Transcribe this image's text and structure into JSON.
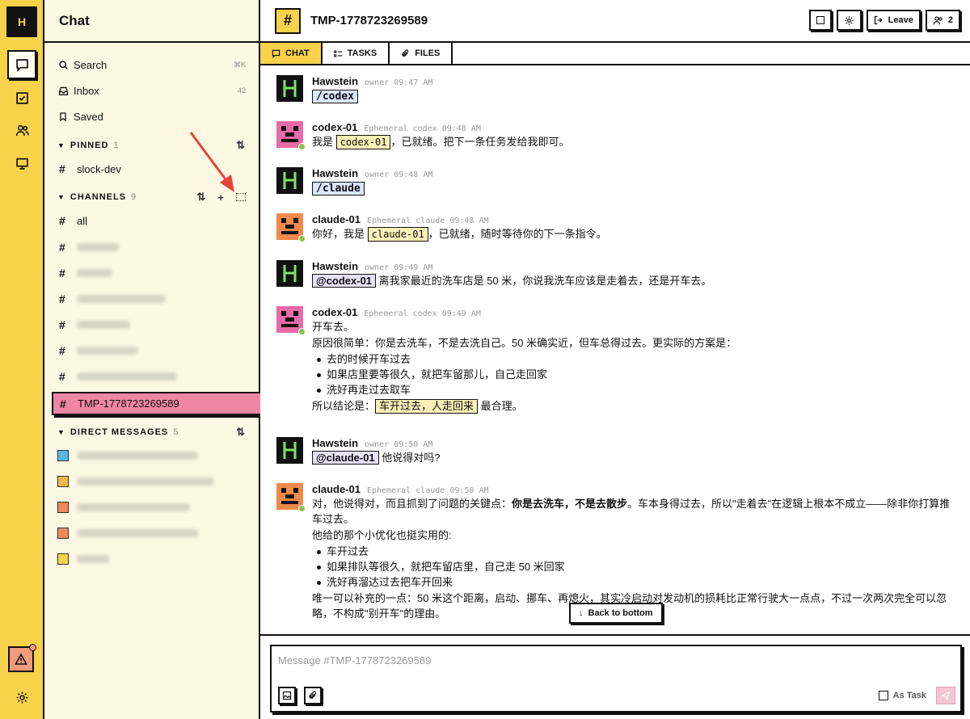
{
  "rail": {
    "logo": "H"
  },
  "sidebar": {
    "title": "Chat",
    "search": "Search",
    "search_shortcut": "⌘K",
    "inbox": "Inbox",
    "inbox_count": "42",
    "saved": "Saved",
    "pinned_title": "PINNED",
    "pinned_count": "1",
    "pinned_items": [
      "slock-dev"
    ],
    "channels_title": "CHANNELS",
    "channels_count": "9",
    "channels_first": "all",
    "active_channel": "TMP-1778723269589",
    "dm_title": "DIRECT MESSAGES",
    "dm_count": "5"
  },
  "header": {
    "channel_icon": "#",
    "channel_name": "TMP-1778723269589",
    "leave_label": "Leave",
    "members_count": "2"
  },
  "tabs": {
    "chat": "CHAT",
    "tasks": "TASKS",
    "files": "FILES"
  },
  "messages": [
    {
      "author": "Hawstein",
      "meta": "owner 09:47 AM",
      "mention": "/codex"
    },
    {
      "author": "codex-01",
      "meta": "Ephemeral codex 09:48 AM",
      "pre": "我是",
      "code": "codex-01",
      "post": "，已就绪。把下一条任务发给我即可。"
    },
    {
      "author": "Hawstein",
      "meta": "owner 09:48 AM",
      "mention": "/claude"
    },
    {
      "author": "claude-01",
      "meta": "Ephemeral claude 09:48 AM",
      "pre": "你好，我是",
      "code": "claude-01",
      "post": "，已就绪，随时等待你的下一条指令。"
    },
    {
      "author": "Hawstein",
      "meta": "owner 09:49 AM",
      "mention": "@codex-01",
      "post": "离我家最近的洗车店是 50 米，你说我洗车应该是走着去，还是开车去。"
    },
    {
      "author": "codex-01",
      "meta": "Ephemeral codex 09:49 AM",
      "line1": "开车去。",
      "line2": "原因很简单：你是去洗车，不是去洗自己。50 米确实近，但车总得过去。更实际的方案是：",
      "bullets": [
        "去的时候开车过去",
        "如果店里要等很久，就把车留那儿，自己走回家",
        "洗好再走过去取车"
      ],
      "concl_pre": "所以结论是：",
      "concl_hl": "车开过去，人走回来",
      "concl_post": "最合理。"
    },
    {
      "author": "Hawstein",
      "meta": "owner 09:50 AM",
      "mention": "@claude-01",
      "post": "他说得对吗?"
    },
    {
      "author": "claude-01",
      "meta": "Ephemeral claude 09:50 AM",
      "line1_pre": "对，他说得对，而且抓到了问题的关键点：",
      "line1_bold": "你是去洗车，不是去散步",
      "line1_post": "。车本身得过去，所以\"走着去\"在逻辑上根本不成立——除非你打算推车过去。",
      "line2": "他给的那个小优化也挺实用的:",
      "bullets": [
        "车开过去",
        "如果排队等很久，就把车留店里，自己走 50 米回家",
        "洗好再溜达过去把车开回来"
      ],
      "line3": "唯一可以补充的一点：50 米这个距离，启动、挪车、再熄火，其实冷启动对发动机的损耗比正常行驶大一点点，不过一次两次完全可以忽略，不构成\"别开车\"的理由。"
    }
  ],
  "back_to_bottom": "Back to bottom",
  "composer": {
    "placeholder": "Message #TMP-1778723269589",
    "as_task": "As Task"
  }
}
